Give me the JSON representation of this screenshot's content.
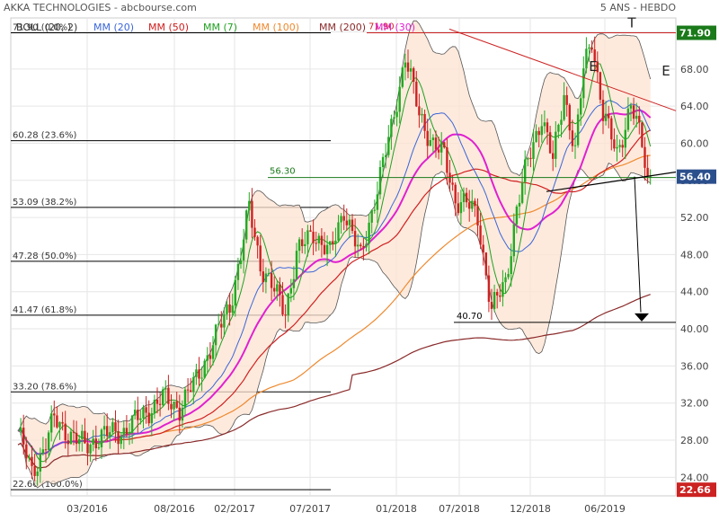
{
  "header": {
    "title": "AKKA TECHNOLOGIES - abcbourse.com",
    "period": "5 ANS - HEBDO"
  },
  "legend": [
    {
      "label": "BOLL (20, 2)",
      "color": "#333333"
    },
    {
      "label": "MM (20)",
      "color": "#3b66d8"
    },
    {
      "label": "MM (50)",
      "color": "#d02020"
    },
    {
      "label": "MM (7)",
      "color": "#20a020"
    },
    {
      "label": "MM (100)",
      "color": "#ee8a30"
    },
    {
      "label": "MM (200)",
      "color": "#8a2a2a"
    },
    {
      "label": "MM (30)",
      "color": "#e020d0"
    }
  ],
  "annotations": {
    "fib": [
      {
        "label": "71.90 (0.0%)",
        "value": 71.9
      },
      {
        "label": "60.28 (23.6%)",
        "value": 60.28
      },
      {
        "label": "53.09 (38.2%)",
        "value": 53.09
      },
      {
        "label": "47.28 (50.0%)",
        "value": 47.28
      },
      {
        "label": "41.47 (61.8%)",
        "value": 41.47
      },
      {
        "label": "33.20 (78.6%)",
        "value": 33.2
      },
      {
        "label": "22.66 (100.0%)",
        "value": 22.66
      }
    ],
    "resistance": {
      "label": "71.90",
      "value": 71.9
    },
    "support": {
      "label": "56.30",
      "value": 56.3
    },
    "target": {
      "label": "40.70",
      "value": 40.7
    },
    "pattern": {
      "shoulder_left": "E",
      "head": "T",
      "shoulder_right": "E"
    }
  },
  "chart_data": {
    "type": "candlestick",
    "title": "AKKA TECHNOLOGIES - abcbourse.com",
    "x_ticks": [
      "03/2016",
      "08/2016",
      "02/2017",
      "07/2017",
      "01/2018",
      "07/2018",
      "12/2018",
      "06/2019"
    ],
    "y_ticks": [
      "24.00",
      "28.00",
      "32.00",
      "36.00",
      "40.00",
      "44.00",
      "48.00",
      "52.00",
      "56.00",
      "60.00",
      "64.00",
      "68.00",
      "72.00"
    ],
    "ylim": [
      22,
      73.5
    ],
    "price_tags": {
      "last": "56.40",
      "high": "71.90",
      "low": "22.66"
    },
    "anchors": [
      [
        0,
        29
      ],
      [
        5,
        24.5
      ],
      [
        9,
        27
      ],
      [
        13,
        30.2
      ],
      [
        18,
        28.8
      ],
      [
        24,
        27.3
      ],
      [
        30,
        28.5
      ],
      [
        38,
        29
      ],
      [
        45,
        30.8
      ],
      [
        52,
        32.5
      ],
      [
        58,
        31.5
      ],
      [
        64,
        34.5
      ],
      [
        70,
        38.5
      ],
      [
        76,
        42.5
      ],
      [
        80,
        48
      ],
      [
        83,
        53
      ],
      [
        87,
        47
      ],
      [
        92,
        44
      ],
      [
        96,
        42
      ],
      [
        100,
        48
      ],
      [
        106,
        50.5
      ],
      [
        112,
        48
      ],
      [
        117,
        53
      ],
      [
        123,
        47.5
      ],
      [
        128,
        54
      ],
      [
        134,
        61.5
      ],
      [
        139,
        69.5
      ],
      [
        144,
        63
      ],
      [
        149,
        60
      ],
      [
        153,
        58.5
      ],
      [
        157,
        54
      ],
      [
        161,
        53.5
      ],
      [
        165,
        52
      ],
      [
        170,
        42
      ],
      [
        175,
        45
      ],
      [
        179,
        53
      ],
      [
        183,
        58
      ],
      [
        188,
        63
      ],
      [
        192,
        58
      ],
      [
        196,
        65.5
      ],
      [
        200,
        59
      ],
      [
        203,
        68
      ],
      [
        206,
        71.5
      ],
      [
        210,
        63
      ],
      [
        215,
        59
      ],
      [
        220,
        64
      ],
      [
        224,
        60
      ],
      [
        226,
        56.4
      ]
    ],
    "series": [
      {
        "name": "BOLL (20, 2)"
      },
      {
        "name": "MM (20)"
      },
      {
        "name": "MM (50)"
      },
      {
        "name": "MM (7)"
      },
      {
        "name": "MM (100)"
      },
      {
        "name": "MM (200)"
      },
      {
        "name": "MM (30)"
      }
    ],
    "up_color": "#22aa22",
    "down_color": "#cc2222"
  }
}
